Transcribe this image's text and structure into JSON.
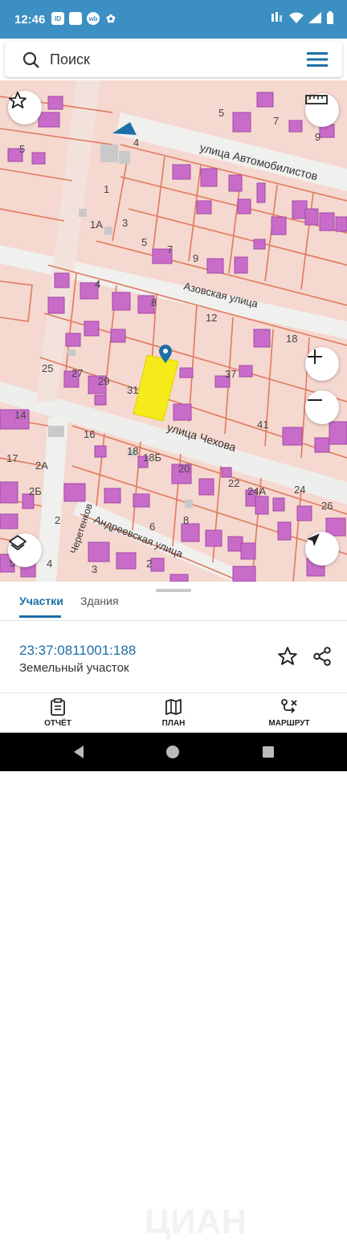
{
  "status_bar": {
    "time": "12:46",
    "app_icons": [
      "ID",
      "",
      "wb",
      "✿"
    ]
  },
  "search": {
    "placeholder": "Поиск"
  },
  "map": {
    "streets": [
      "улица Автомобилистов",
      "Азовская улица",
      "улица Чехова",
      "Андреевская улица",
      "Черетенков"
    ],
    "house_numbers": [
      "5",
      "7",
      "5",
      "4",
      "9",
      "1",
      "1А",
      "3",
      "5",
      "7",
      "9",
      "4",
      "8",
      "12",
      "18",
      "25",
      "27",
      "29",
      "31",
      "37",
      "41",
      "14",
      "16",
      "18",
      "18Б",
      "20",
      "22",
      "24А",
      "24",
      "26",
      "17",
      "2А",
      "2Б",
      "2",
      "6",
      "8",
      "3",
      "4",
      "2",
      "5"
    ]
  },
  "bottom_sheet": {
    "tabs": [
      "Участки",
      "Здания"
    ],
    "cadastral_number": "23:37:0811001:188",
    "object_type": "Земельный участок"
  },
  "bottom_nav": {
    "items": [
      "ОТЧЁТ",
      "ПЛАН",
      "МАРШРУТ"
    ]
  }
}
